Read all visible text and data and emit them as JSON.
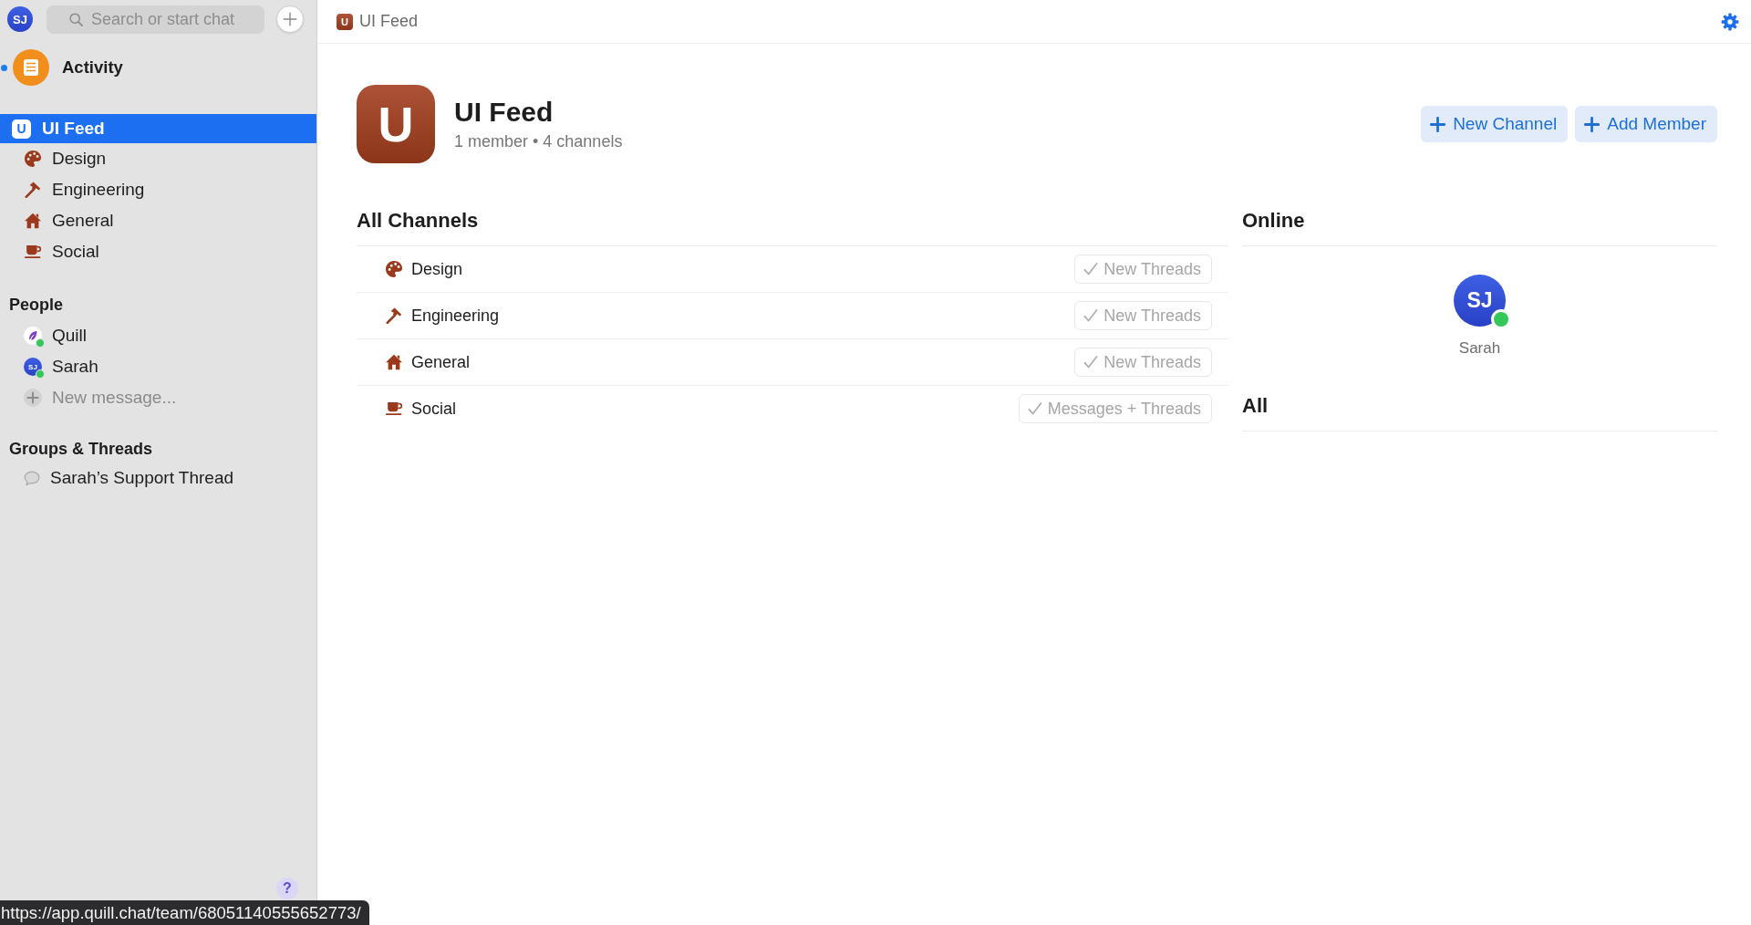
{
  "sidebar": {
    "account": {
      "initials": "SJ"
    },
    "search": {
      "placeholder": "Search or start chat"
    },
    "activity": {
      "label": "Activity",
      "unread": true
    },
    "teams": [
      {
        "badge": "U",
        "name": "UI Feed",
        "selected": true,
        "channels": [
          {
            "name": "Design",
            "selected": false
          },
          {
            "name": "Engineering",
            "selected": false
          },
          {
            "name": "General",
            "selected": false
          },
          {
            "name": "Social",
            "selected": false
          }
        ]
      }
    ],
    "people": {
      "title": "People",
      "items": [
        {
          "kind": "logo",
          "name": "Quill",
          "online": true
        },
        {
          "kind": "initials",
          "initials": "SJ",
          "name": "Sarah",
          "online": true
        }
      ],
      "new_message": "New message..."
    },
    "groups": {
      "title": "Groups & Threads",
      "items": [
        {
          "name": "Sarah’s Support Thread"
        }
      ]
    },
    "help": "?"
  },
  "topbar": {
    "badge": "U",
    "title": "UI Feed"
  },
  "team_header": {
    "badge": "U",
    "title": "UI Feed",
    "subtitle": "1 member • 4 channels",
    "actions": [
      {
        "label": "New Channel"
      },
      {
        "label": "Add Member"
      }
    ]
  },
  "channels_panel": {
    "title": "All Channels",
    "rows": [
      {
        "name": "Design",
        "notifications": "New Threads"
      },
      {
        "name": "Engineering",
        "notifications": "New Threads"
      },
      {
        "name": "General",
        "notifications": "New Threads"
      },
      {
        "name": "Social",
        "notifications": "Messages + Threads"
      }
    ]
  },
  "members_panel": {
    "online_title": "Online",
    "online": [
      {
        "initials": "SJ",
        "name": "Sarah",
        "online": true
      }
    ],
    "all_title": "All"
  },
  "status_url": "https://app.quill.chat/team/68051140555652773/"
}
